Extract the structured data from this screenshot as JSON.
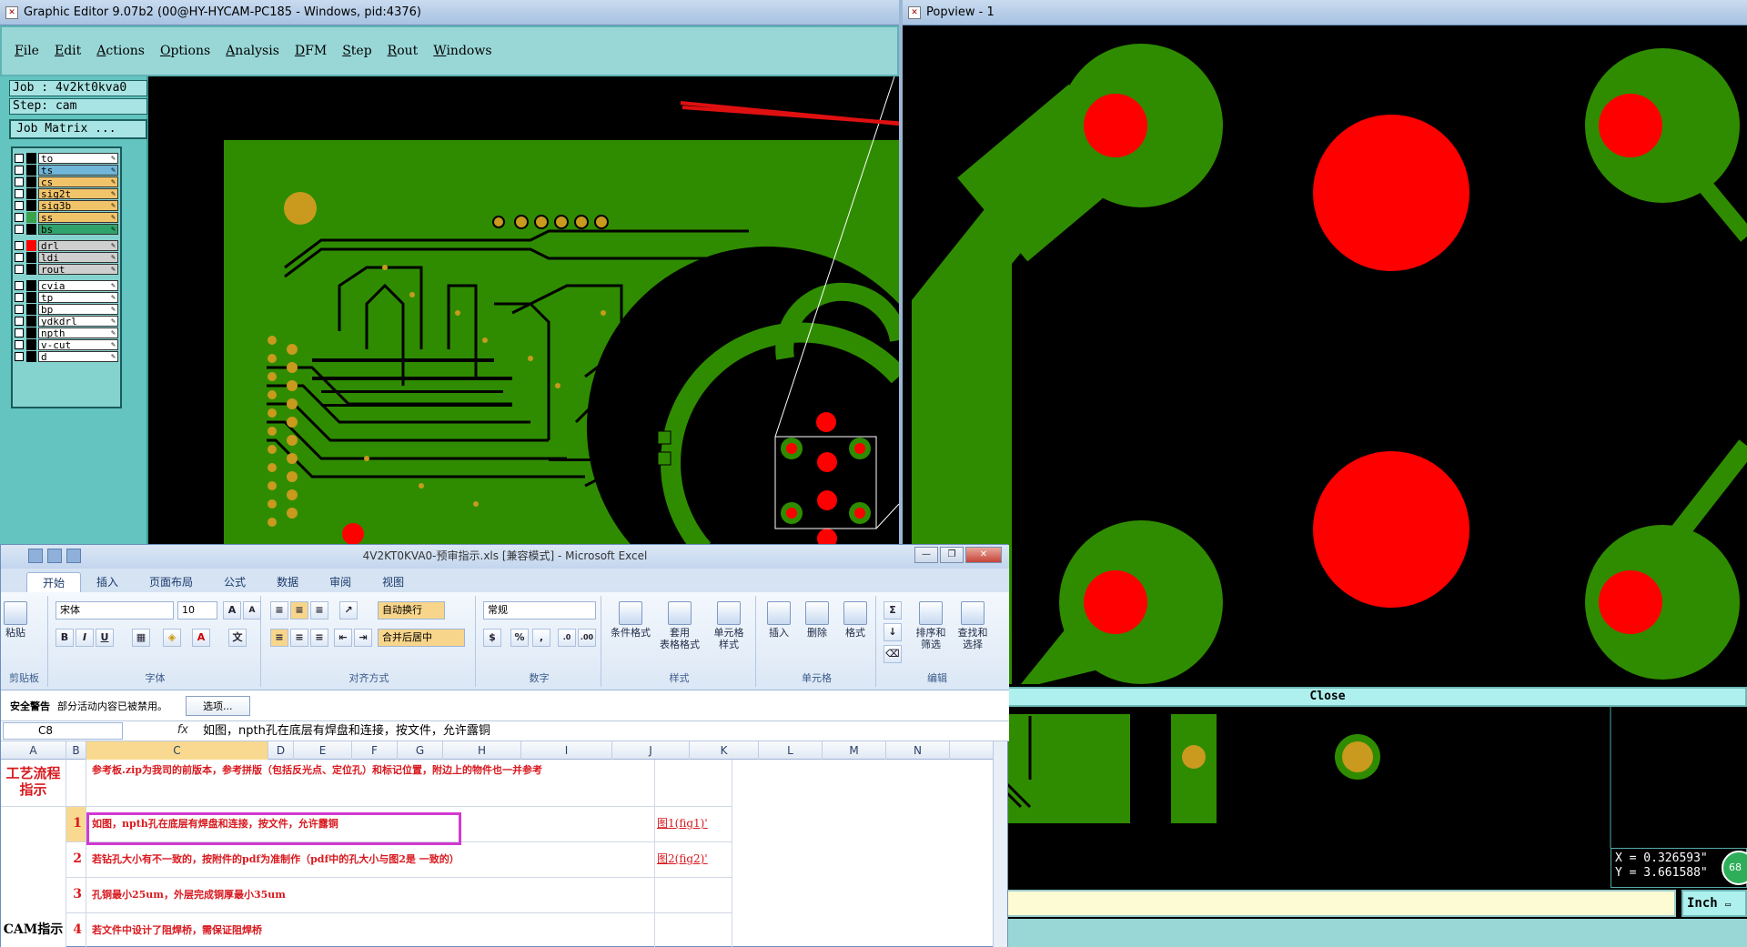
{
  "graphic_editor": {
    "title": "Graphic Editor 9.07b2 (00@HY-HYCAM-PC185 - Windows, pid:4376)",
    "menu": [
      "File",
      "Edit",
      "Actions",
      "Options",
      "Analysis",
      "DFM",
      "Step",
      "Rout",
      "Windows"
    ],
    "job": "Job : 4v2kt0kva0",
    "step": "Step: cam",
    "job_matrix": "Job Matrix ...",
    "layers": [
      {
        "name": "to",
        "color": "#ffffff",
        "swatch": "#000000"
      },
      {
        "name": "ts",
        "color": "#6fb6d8",
        "swatch": "#000000"
      },
      {
        "name": "cs",
        "color": "#f2c46a",
        "swatch": "#000000"
      },
      {
        "name": "sig2t",
        "color": "#f2c46a",
        "swatch": "#000000"
      },
      {
        "name": "sig3b",
        "color": "#f2c46a",
        "swatch": "#000000"
      },
      {
        "name": "ss",
        "color": "#f2c46a",
        "swatch": "#3aa24a"
      },
      {
        "name": "bs",
        "color": "#2fa36b",
        "swatch": "#000000"
      },
      {
        "name": "drl",
        "color": "#cfcfcf",
        "swatch": "#ff0000"
      },
      {
        "name": "ldi",
        "color": "#cfcfcf",
        "swatch": "#000000"
      },
      {
        "name": "rout",
        "color": "#cfcfcf",
        "swatch": "#000000"
      },
      {
        "name": "cvia",
        "color": "#ffffff",
        "swatch": "#000000"
      },
      {
        "name": "tp",
        "color": "#ffffff",
        "swatch": "#000000"
      },
      {
        "name": "bp",
        "color": "#ffffff",
        "swatch": "#000000"
      },
      {
        "name": "ydkdrl",
        "color": "#ffffff",
        "swatch": "#000000"
      },
      {
        "name": "npth",
        "color": "#ffffff",
        "swatch": "#000000"
      },
      {
        "name": "v-cut",
        "color": "#ffffff",
        "swatch": "#000000"
      },
      {
        "name": "d",
        "color": "#ffffff",
        "swatch": "#000000"
      }
    ],
    "colors": {
      "board": "#2f8c00",
      "copper": "#3f9a06",
      "drill": "#ff0000",
      "pad": "#c99a1d"
    }
  },
  "popview": {
    "title": "Popview - 1",
    "close_label": "Close",
    "coord_x": "X = 0.326593\"",
    "coord_y": "Y = 3.661588\"",
    "unit": "Inch",
    "zoom_badge": "68"
  },
  "excel": {
    "title": "4V2KT0KVA0-预审指示.xls  [兼容模式] - Microsoft Excel",
    "tabs": [
      "开始",
      "插入",
      "页面布局",
      "公式",
      "数据",
      "审阅",
      "视图"
    ],
    "ribbon": {
      "paste": "粘贴",
      "clipboard": "剪贴板",
      "font_name": "宋体",
      "font_size": "10",
      "font_group": "字体",
      "wrap": "自动换行",
      "merge": "合并后居中",
      "align_group": "对齐方式",
      "number_format": "常规",
      "number_group": "数字",
      "cond_format": "条件格式",
      "table_format": "套用\n表格格式",
      "cell_style": "单元格\n样式",
      "style_group": "样式",
      "insert": "插入",
      "delete": "删除",
      "format": "格式",
      "cells_group": "单元格",
      "sort": "排序和\n筛选",
      "find": "查找和\n选择",
      "edit_group": "编辑"
    },
    "security_warning": "安全警告",
    "security_msg": "部分活动内容已被禁用。",
    "options_btn": "选项...",
    "name_box": "C8",
    "fx": "fx",
    "formula": "如图，npth孔在底层有焊盘和连接，按文件，允许露铜",
    "columns": [
      "A",
      "B",
      "C",
      "D",
      "E",
      "F",
      "G",
      "H",
      "I",
      "J",
      "K",
      "L",
      "M",
      "N"
    ],
    "header_a": "工艺流程指示",
    "header_c": "参考板.zip为我司的前版本，参考拼版（包括反光点、定位孔）和标记位置，附边上的物件也一并参考",
    "section_a": "CAM指示",
    "rows": [
      {
        "num": "1",
        "text": "如图，npth孔在底层有焊盘和连接，按文件，允许露铜",
        "link": "图1(fig1)'"
      },
      {
        "num": "2",
        "text": "若钻孔大小有不一致的，按附件的pdf为准制作（pdf中的孔大小与图2是 一致的）",
        "link": "图2(fig2)'"
      },
      {
        "num": "3",
        "text": "孔铜最小25um，外层完成铜厚最小35um",
        "link": ""
      },
      {
        "num": "4",
        "text": "若文件中设计了阻焊桥，需保证阻焊桥",
        "link": ""
      }
    ]
  }
}
